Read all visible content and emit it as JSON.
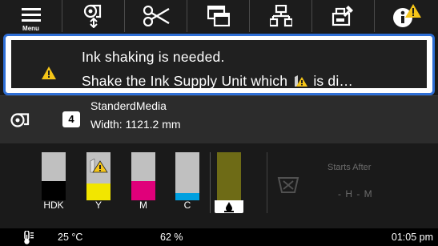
{
  "toolbar": {
    "menu_label": "Menu",
    "buttons": [
      {
        "name": "menu-icon"
      },
      {
        "name": "media-feed-icon"
      },
      {
        "name": "cut-icon"
      },
      {
        "name": "layout-icon"
      },
      {
        "name": "network-icon"
      },
      {
        "name": "maintenance-icon"
      },
      {
        "name": "info-warning-icon"
      }
    ],
    "warning_color": "#f5c518"
  },
  "alert": {
    "line1": "Ink shaking is needed.",
    "line2_before": "Shake the Ink Supply Unit which",
    "line2_after": "is di…",
    "border_color": "#2f6fd6"
  },
  "media": {
    "slot": "4",
    "name": "StanderdMedia",
    "width": "Width: 1121.2 mm"
  },
  "inks": [
    {
      "label": "HDK",
      "color": "#000000",
      "level": 0.4
    },
    {
      "label": "Y",
      "color": "#f2e600",
      "level": 0.35,
      "warning": true
    },
    {
      "label": "M",
      "color": "#e0007a",
      "level": 0.4
    },
    {
      "label": "C",
      "color": "#00a0e0",
      "level": 0.15
    }
  ],
  "waste": {
    "color": "#6e6b16"
  },
  "maintenance": {
    "starts_after_label": "Starts After",
    "time_display": "- H - M"
  },
  "status": {
    "temperature": "25 °C",
    "humidity": "62 %",
    "time": "01:05 pm"
  }
}
